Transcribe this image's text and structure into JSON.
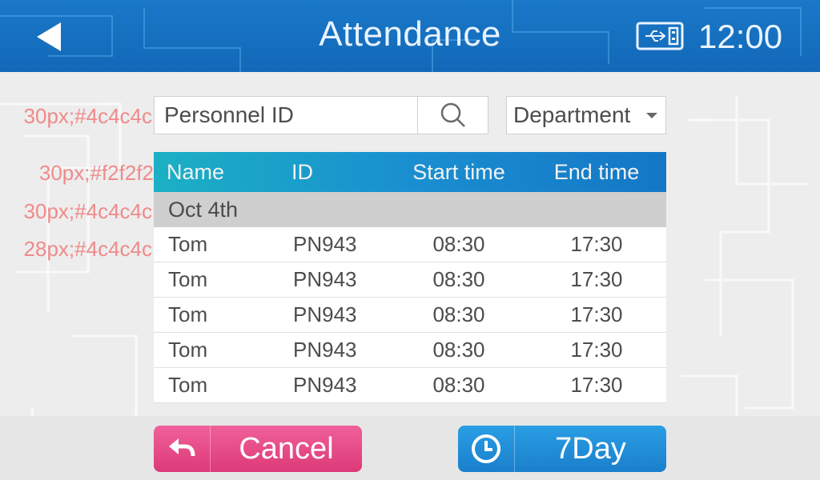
{
  "header": {
    "title": "Attendance",
    "time": "12:00",
    "back_icon": "back-triangle-icon",
    "usb_icon": "usb-icon"
  },
  "notes": [
    "30px;#4c4c4c",
    "30px;#f2f2f2",
    "30px;#4c4c4c",
    "28px;#4c4c4c"
  ],
  "search": {
    "placeholder": "Personnel ID",
    "icon": "search-icon"
  },
  "department": {
    "label": "Department"
  },
  "table": {
    "columns": [
      "Name",
      "ID",
      "Start time",
      "End time"
    ],
    "group": "Oct 4th",
    "rows": [
      [
        "Tom",
        "PN943",
        "08:30",
        "17:30"
      ],
      [
        "Tom",
        "PN943",
        "08:30",
        "17:30"
      ],
      [
        "Tom",
        "PN943",
        "08:30",
        "17:30"
      ],
      [
        "Tom",
        "PN943",
        "08:30",
        "17:30"
      ],
      [
        "Tom",
        "PN943",
        "08:30",
        "17:30"
      ]
    ]
  },
  "buttons": {
    "cancel": "Cancel",
    "seven_day": "7Day"
  },
  "colors": {
    "header": "#1a78c8",
    "text": "#4c4c4c",
    "header_text": "#f2f2f2",
    "cancel": "#e04a86",
    "seven_day": "#1f8ad6",
    "note": "#f08a8a"
  }
}
